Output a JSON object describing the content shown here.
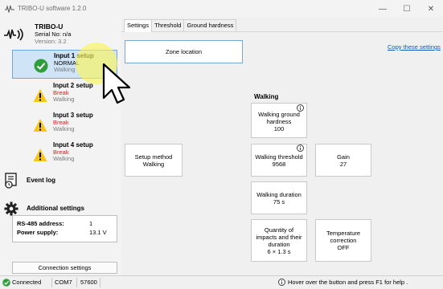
{
  "window": {
    "title": "TRIBO-U software 1.2.0",
    "minimize_glyph": "—",
    "maximize_glyph": "☐",
    "close_glyph": "✕"
  },
  "brand": {
    "name": "TRIBO-U",
    "serial": "Serial No: n/a",
    "version": "Version: 3.2"
  },
  "inputs": [
    {
      "label": "Input 1 setup",
      "status": "NORMAL",
      "activity": "Walking",
      "state": "ok"
    },
    {
      "label": "Input 2 setup",
      "status": "Break",
      "activity": "Walking",
      "state": "warning"
    },
    {
      "label": "Input 3 setup",
      "status": "Break",
      "activity": "Walking",
      "state": "warning"
    },
    {
      "label": "Input 4 setup",
      "status": "Break",
      "activity": "Walking",
      "state": "warning"
    }
  ],
  "menu": {
    "event_log": "Event log",
    "additional_settings": "Additional settings"
  },
  "device_info": {
    "address_label": "RS-485 address:",
    "address_value": "1",
    "power_label": "Power supply:",
    "power_value": "13.1 V"
  },
  "connection_settings_label": "Connection settings",
  "tabs": [
    {
      "label": "Settings",
      "active": true
    },
    {
      "label": "Threshold",
      "active": false
    },
    {
      "label": "Ground hardness",
      "active": false
    }
  ],
  "settings": {
    "zone_location": "Zone location",
    "copy_link": "Copy these settings",
    "walking_header": "Walking",
    "setup_method": {
      "label": "Setup method",
      "value": "Walking"
    },
    "ground_hardness": {
      "label": "Walking ground hardness",
      "value": "100"
    },
    "walking_threshold": {
      "label": "Walking threshold",
      "value": "9568"
    },
    "gain": {
      "label": "Gain",
      "value": "27"
    },
    "walking_duration": {
      "label": "Walking duration",
      "value": "75 s"
    },
    "impacts": {
      "label": "Quantity of impacts and their duration",
      "value": "6 × 1.3 s"
    },
    "temp_correction": {
      "label": "Temperature correction",
      "value": "OFF"
    }
  },
  "statusbar": {
    "connection": "Connected",
    "port": "COM7",
    "baud": "57600",
    "hint": "Hover over the button and press F1 for help ."
  },
  "colors": {
    "accent": "#0f5ab4",
    "ok_green": "#2e9d3a",
    "warning_yellow": "#f5c518",
    "break_red": "#d42020",
    "selection": "#cfe4f7"
  }
}
